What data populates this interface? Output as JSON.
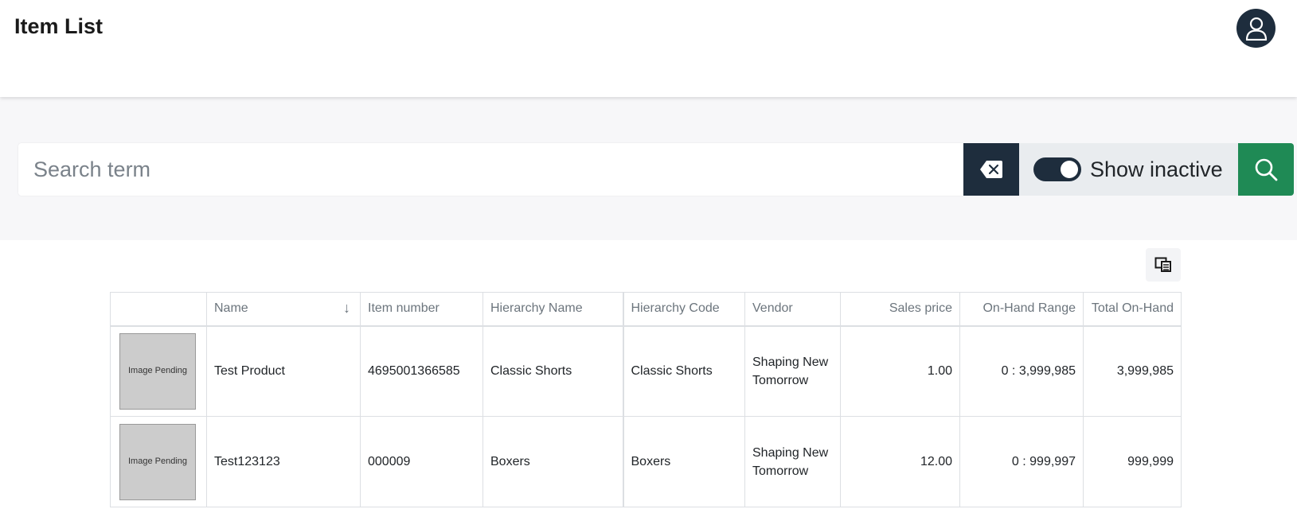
{
  "header": {
    "title": "Item List",
    "avatar_icon": "user-icon"
  },
  "search": {
    "placeholder": "Search term",
    "value": "",
    "clear_icon": "backspace-icon",
    "show_inactive_label": "Show inactive",
    "show_inactive_checked": true,
    "search_icon": "search-icon"
  },
  "toolbar": {
    "columns_icon": "column-chooser-icon"
  },
  "table": {
    "columns": [
      {
        "label": ""
      },
      {
        "label": "Name",
        "sort": "descending"
      },
      {
        "label": "Item number"
      },
      {
        "label": "Hierarchy Name"
      },
      {
        "label": "Hierarchy Code"
      },
      {
        "label": "Vendor"
      },
      {
        "label": "Sales price"
      },
      {
        "label": "On-Hand Range"
      },
      {
        "label": "Total On-Hand"
      }
    ],
    "rows": [
      {
        "image_text": "Image Pending",
        "name": "Test Product",
        "item_number": "4695001366585",
        "hierarchy_name": "Classic Shorts",
        "hierarchy_code": "Classic Shorts",
        "vendor_line1": "Shaping New",
        "vendor_line2": "Tomorrow",
        "sales_price": "1.00",
        "on_hand_range": "0 : 3,999,985",
        "total_on_hand": "3,999,985"
      },
      {
        "image_text": "Image Pending",
        "name": "Test123123",
        "item_number": "000009",
        "hierarchy_name": "Boxers",
        "hierarchy_code": "Boxers",
        "vendor_line1": "Shaping New",
        "vendor_line2": "Tomorrow",
        "sales_price": "12.00",
        "on_hand_range": "0 : 999,997",
        "total_on_hand": "999,999"
      }
    ]
  },
  "colors": {
    "navy": "#1e2d3d",
    "green": "#1f8a55",
    "band": "#f7f7f9"
  }
}
